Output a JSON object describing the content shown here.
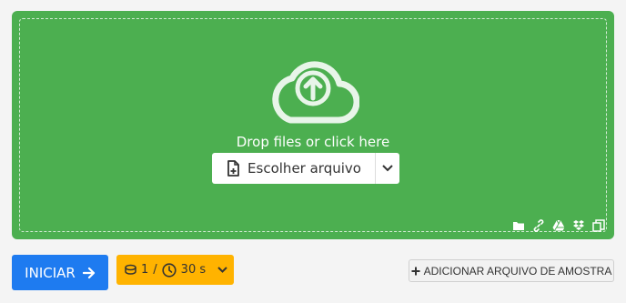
{
  "dropzone": {
    "prompt": "Drop files or click here",
    "choose_label": "Escolher arquivo",
    "background_color": "#4caf50",
    "source_icons": [
      "folder-icon",
      "link-icon",
      "google-drive-icon",
      "dropbox-icon",
      "clipboard-icon"
    ]
  },
  "actions": {
    "start_label": "INICIAR",
    "start_color": "#1e7bf0",
    "credits": "1",
    "separator": "/",
    "time": "30 s",
    "credits_color": "#ffb300",
    "sample_label": "ADICIONAR ARQUIVO DE AMOSTRA"
  }
}
